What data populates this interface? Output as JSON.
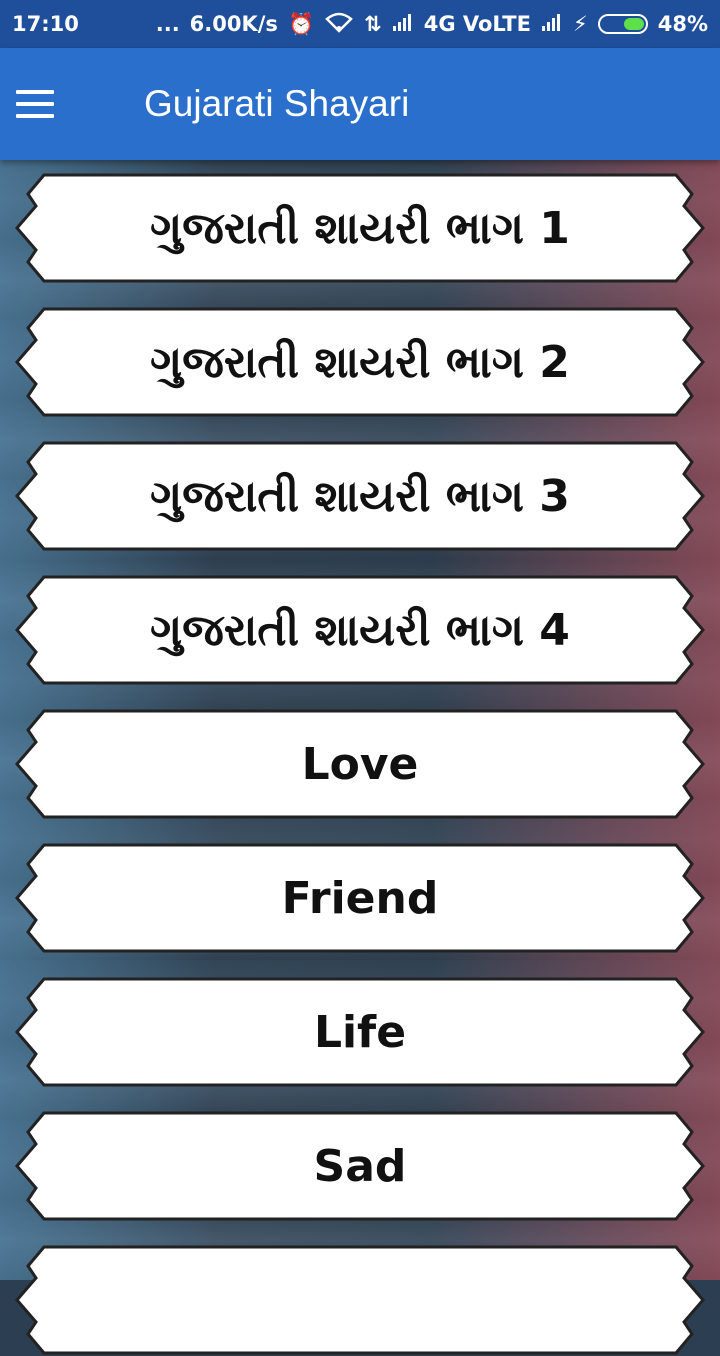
{
  "status_bar": {
    "time": "17:10",
    "dots": "...",
    "network_speed": "6.00K/s",
    "network_type": "4G VoLTE",
    "battery": "48%",
    "icons": [
      "alarm-icon",
      "wifi-icon",
      "data-arrows-icon",
      "signal-icon",
      "signal-icon-2",
      "charging-icon",
      "battery-icon"
    ]
  },
  "app_bar": {
    "title": "Gujarati Shayari",
    "menu_icon": "hamburger-menu-icon"
  },
  "menu_items": [
    {
      "label": "ગુજરાતી શાયરી ભાગ 1"
    },
    {
      "label": "ગુજરાતી શાયરી ભાગ 2"
    },
    {
      "label": "ગુજરાતી શાયરી ભાગ 3"
    },
    {
      "label": "ગુજરાતી શાયરી ભાગ 4"
    },
    {
      "label": "Love"
    },
    {
      "label": "Friend"
    },
    {
      "label": "Life"
    },
    {
      "label": "Sad"
    },
    {
      "label": ""
    }
  ],
  "colors": {
    "status_bar": "#1f4f9a",
    "app_bar": "#2b6fcd",
    "item_background": "#ffffff",
    "item_text": "#111111"
  }
}
